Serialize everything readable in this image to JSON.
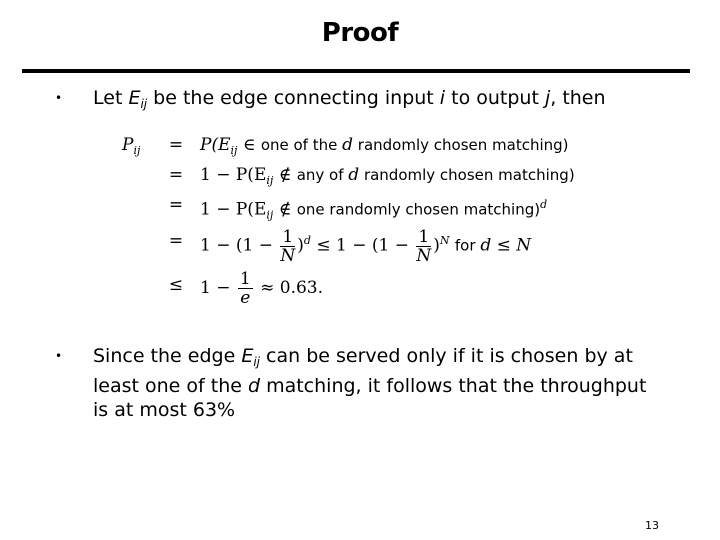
{
  "slide": {
    "title": "Proof",
    "page_number": "13"
  },
  "bullet1": {
    "marker": "•",
    "pre": "Let ",
    "E": "E",
    "ij": "ij",
    "mid": " be the edge connecting input ",
    "i": "i",
    "to": " to output ",
    "j": "j",
    "post": ", then"
  },
  "equations": {
    "lhs": "P",
    "lhs_sub": "ij",
    "rows": [
      {
        "rel": "=",
        "pre": "P(E",
        "sub": "ij",
        "op": " ∈ ",
        "text": "one of the ",
        "var": "d",
        "text2": " randomly chosen matching)"
      },
      {
        "rel": "=",
        "pre": "1 − P(E",
        "sub": "ij",
        "op": " ∉ ",
        "text": "any of ",
        "var": "d",
        "text2": " randomly chosen matching)"
      },
      {
        "rel": "=",
        "pre": "1 − P(E",
        "sub": "ij",
        "op": " ∉ ",
        "text": "one randomly chosen matching)",
        "sup": "d"
      },
      {
        "rel": "=",
        "a": "1 − (1 − ",
        "frac_num": "1",
        "frac_den": "N",
        "sup_d": "d",
        "mid": " ≤ 1 − (1 − ",
        "sup_n": "N",
        "for": "for ",
        "cond": "d ≤ N"
      },
      {
        "rel": "≤",
        "a": "1 − ",
        "frac_num": "1",
        "frac_den": "e",
        "approx": " ≈ 0.63."
      }
    ]
  },
  "bullet2": {
    "marker": "•",
    "pre": "Since the edge ",
    "E": "E",
    "ij": "ij",
    "mid": " can be served only if it is chosen by at least one of the ",
    "d": "d",
    "post": " matching, it follows that the throughput is at most 63%"
  }
}
